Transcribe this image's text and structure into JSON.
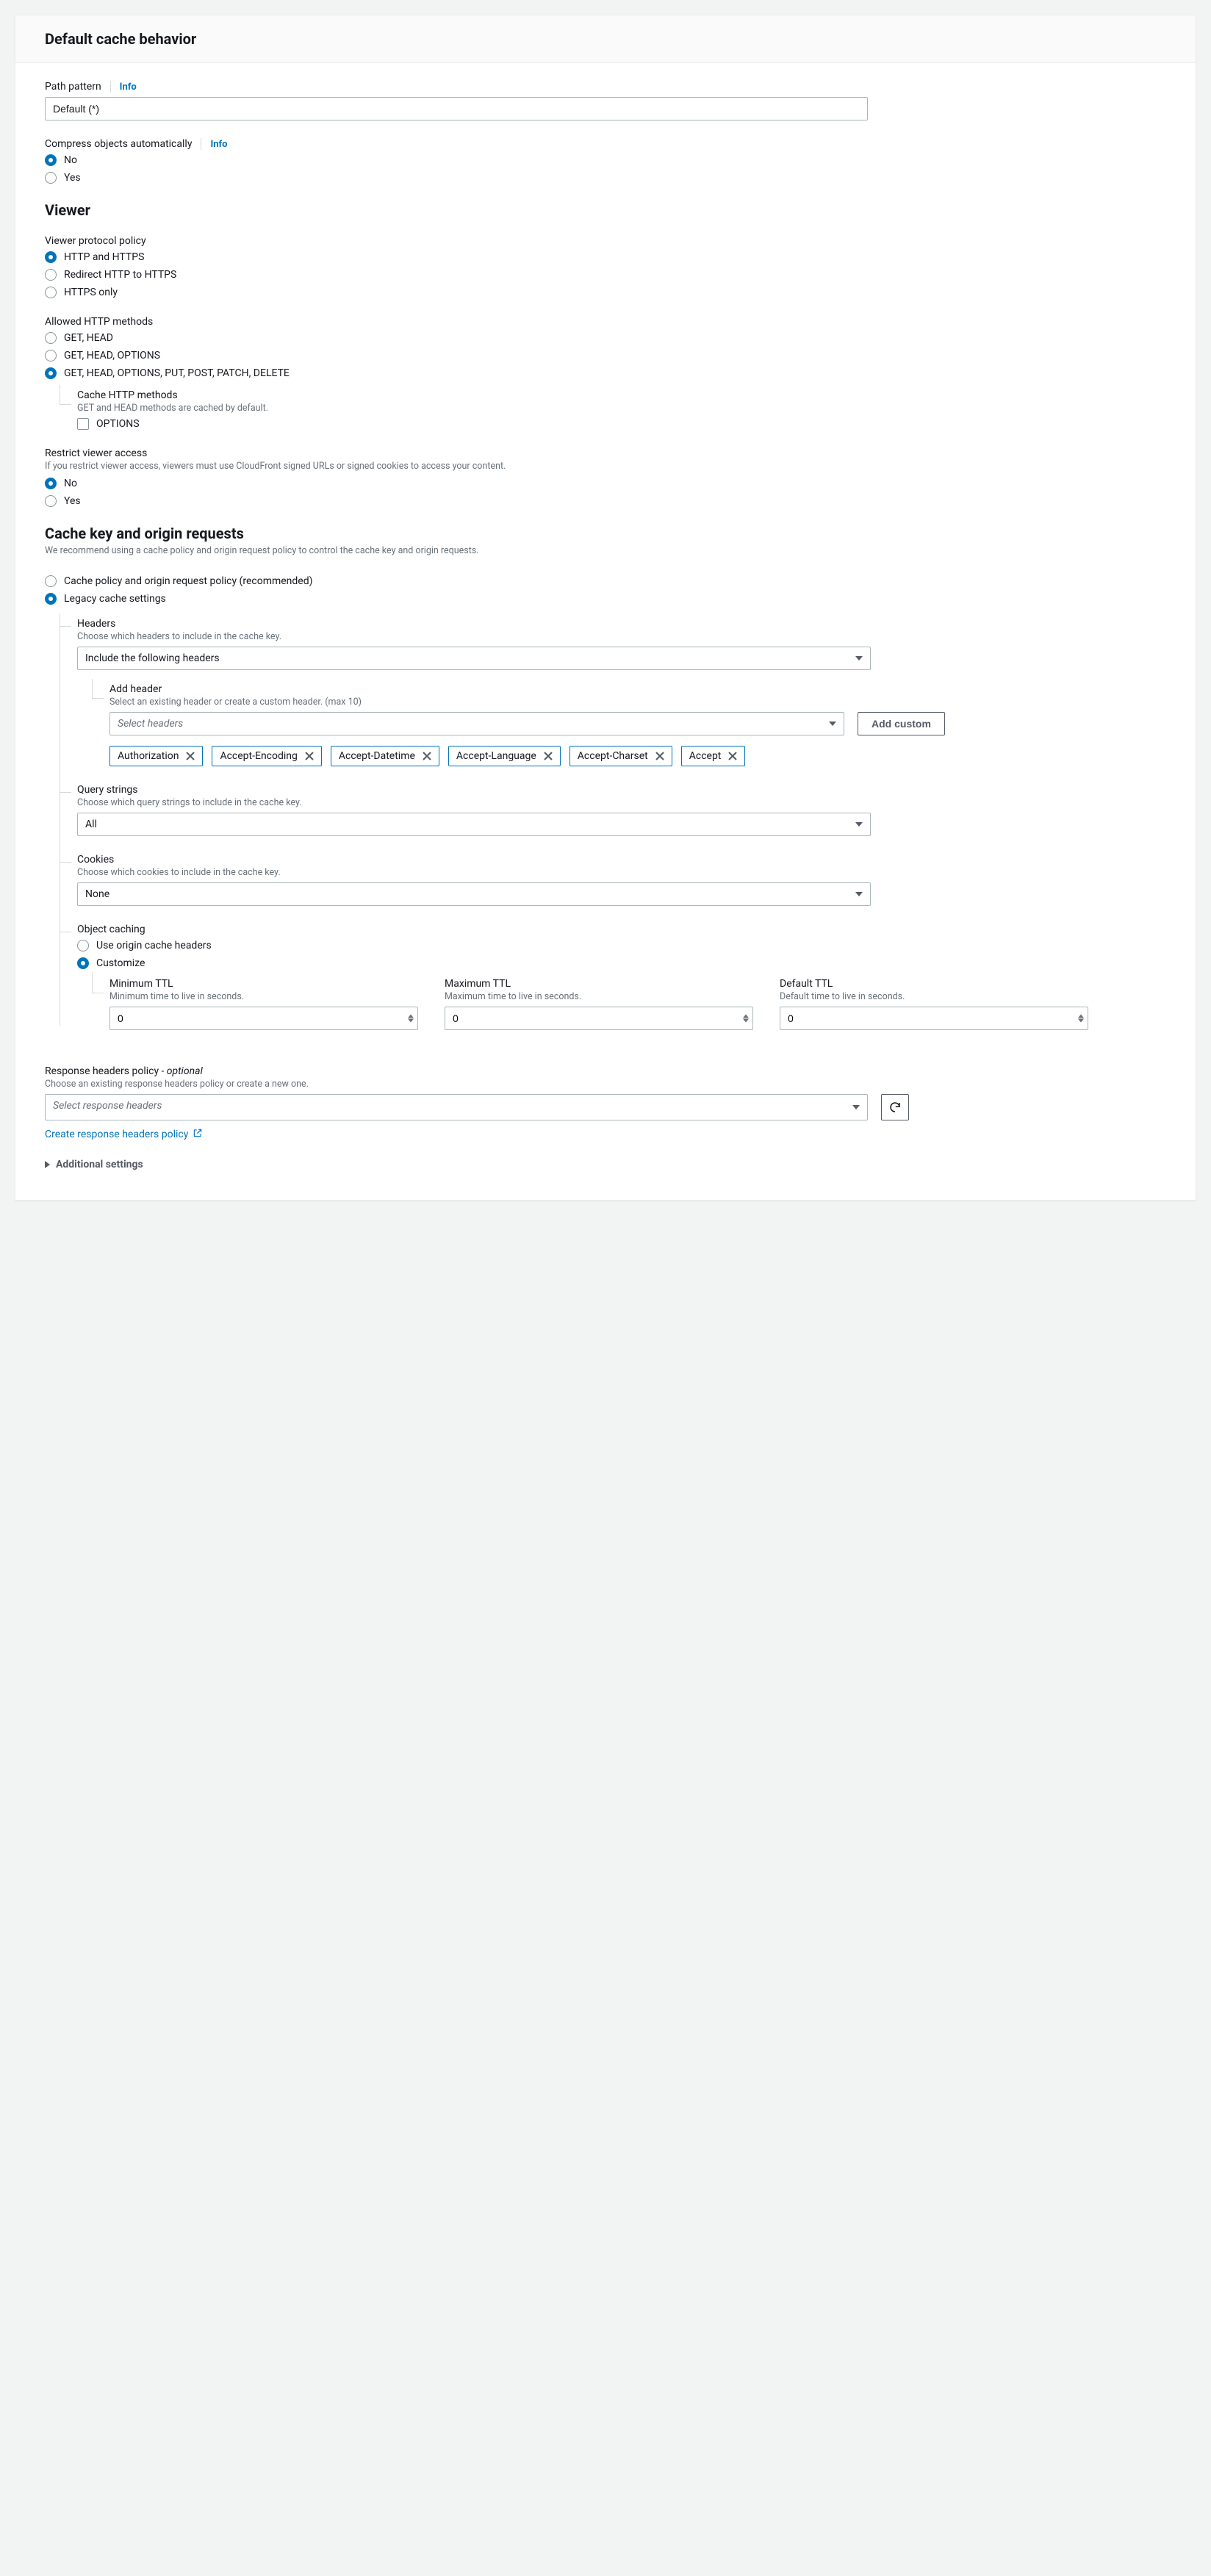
{
  "header": {
    "title": "Default cache behavior"
  },
  "pathPattern": {
    "label": "Path pattern",
    "info": "Info",
    "value": "Default (*)"
  },
  "compress": {
    "label": "Compress objects automatically",
    "info": "Info",
    "options": {
      "no": "No",
      "yes": "Yes"
    },
    "selected": "no"
  },
  "viewer": {
    "heading": "Viewer",
    "protocol": {
      "label": "Viewer protocol policy",
      "options": {
        "both": "HTTP and HTTPS",
        "redirect": "Redirect HTTP to HTTPS",
        "httpsOnly": "HTTPS only"
      },
      "selected": "both"
    },
    "methods": {
      "label": "Allowed HTTP methods",
      "options": {
        "gh": "GET, HEAD",
        "gho": "GET, HEAD, OPTIONS",
        "all": "GET, HEAD, OPTIONS, PUT, POST, PATCH, DELETE"
      },
      "selected": "all",
      "cache": {
        "label": "Cache HTTP methods",
        "hint": "GET and HEAD methods are cached by default.",
        "option": "OPTIONS"
      }
    },
    "restrict": {
      "label": "Restrict viewer access",
      "hint": "If you restrict viewer access, viewers must use CloudFront signed URLs or signed cookies to access your content.",
      "options": {
        "no": "No",
        "yes": "Yes"
      },
      "selected": "no"
    }
  },
  "cacheKey": {
    "heading": "Cache key and origin requests",
    "hint": "We recommend using a cache policy and origin request policy to control the cache key and origin requests.",
    "mode": {
      "options": {
        "policy": "Cache policy and origin request policy (recommended)",
        "legacy": "Legacy cache settings"
      },
      "selected": "legacy"
    },
    "headers": {
      "label": "Headers",
      "hint": "Choose which headers to include in the cache key.",
      "value": "Include the following headers",
      "add": {
        "label": "Add header",
        "hint": "Select an existing header or create a custom header. (max 10)",
        "placeholder": "Select headers",
        "customBtn": "Add custom"
      },
      "tags": [
        "Authorization",
        "Accept-Encoding",
        "Accept-Datetime",
        "Accept-Language",
        "Accept-Charset",
        "Accept"
      ]
    },
    "query": {
      "label": "Query strings",
      "hint": "Choose which query strings to include in the cache key.",
      "value": "All"
    },
    "cookies": {
      "label": "Cookies",
      "hint": "Choose which cookies to include in the cache key.",
      "value": "None"
    },
    "objectCaching": {
      "label": "Object caching",
      "options": {
        "origin": "Use origin cache headers",
        "custom": "Customize"
      },
      "selected": "custom",
      "ttl": {
        "min": {
          "label": "Minimum TTL",
          "hint": "Minimum time to live in seconds.",
          "value": "0"
        },
        "max": {
          "label": "Maximum TTL",
          "hint": "Maximum time to live in seconds.",
          "value": "0"
        },
        "def": {
          "label": "Default TTL",
          "hint": "Default time to live in seconds.",
          "value": "0"
        }
      }
    }
  },
  "responseHeaders": {
    "label": "Response headers policy",
    "optional": " - optional",
    "hint": "Choose an existing response headers policy or create a new one.",
    "placeholder": "Select response headers",
    "createLink": "Create response headers policy"
  },
  "additional": {
    "label": "Additional settings"
  }
}
